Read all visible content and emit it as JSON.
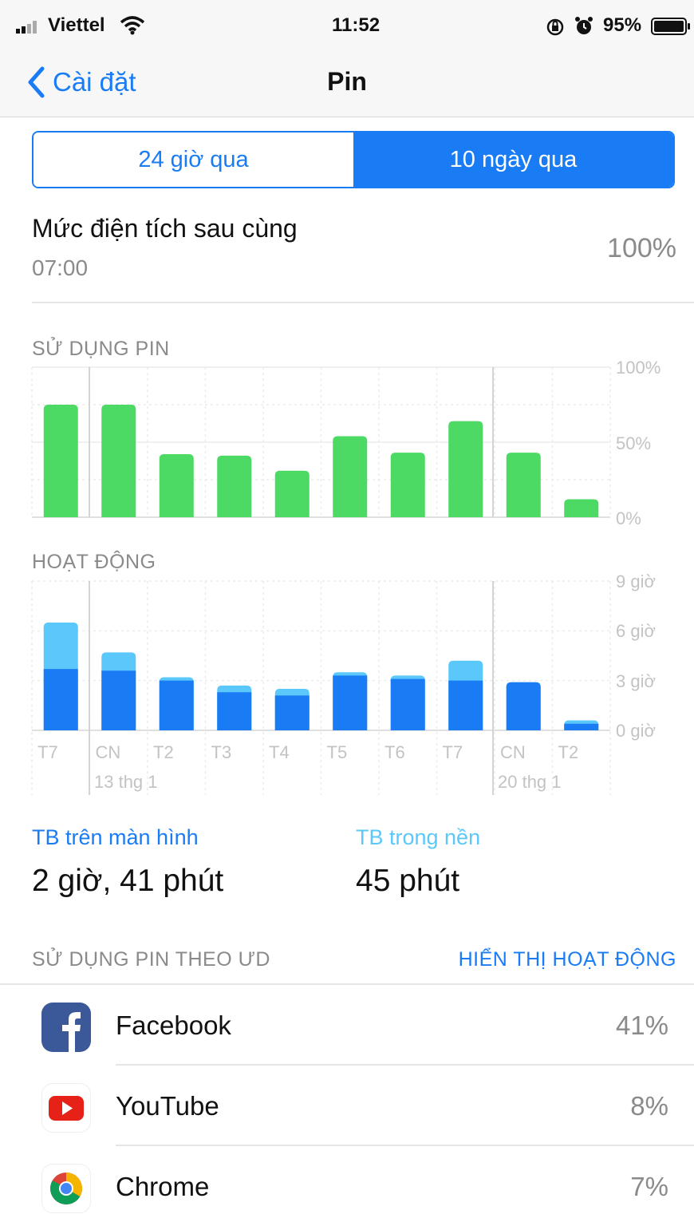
{
  "status": {
    "carrier": "Viettel",
    "time": "11:52",
    "battery": "95%"
  },
  "nav": {
    "back_label": "Cài đặt",
    "title": "Pin"
  },
  "segments": {
    "option1": "24 giờ qua",
    "option2": "10 ngày qua",
    "selected": "10 ngày qua"
  },
  "last_charge": {
    "title": "Mức điện tích sau cùng",
    "time": "07:00",
    "value": "100%"
  },
  "battery_usage": {
    "label": "SỬ DỤNG PIN",
    "ticks": [
      "100%",
      "50%",
      "0%"
    ]
  },
  "activity": {
    "label": "HOẠT ĐỘNG",
    "ticks": [
      "9 giờ",
      "6 giờ",
      "3 giờ",
      "0 giờ"
    ],
    "day_labels": [
      "T7",
      "CN",
      "T2",
      "T3",
      "T4",
      "T5",
      "T6",
      "T7",
      "CN",
      "T2"
    ],
    "date_labels": [
      "13 thg 1",
      "20 thg 1"
    ]
  },
  "chart_data": [
    {
      "type": "bar",
      "title": "SỬ DỤNG PIN",
      "categories": [
        "T7",
        "CN",
        "T2",
        "T3",
        "T4",
        "T5",
        "T6",
        "T7",
        "CN",
        "T2"
      ],
      "values": [
        75,
        75,
        42,
        41,
        31,
        54,
        43,
        64,
        43,
        12
      ],
      "ylim": [
        0,
        100
      ],
      "unit": "%",
      "color": "#4cd964"
    },
    {
      "type": "bar",
      "title": "HOẠT ĐỘNG",
      "categories": [
        "T7",
        "CN",
        "T2",
        "T3",
        "T4",
        "T5",
        "T6",
        "T7",
        "CN",
        "T2"
      ],
      "series": [
        {
          "values": [
            3.7,
            3.6,
            3.0,
            2.3,
            2.1,
            3.3,
            3.1,
            3.0,
            2.9,
            0.4
          ],
          "color": "#1a7cf5"
        },
        {
          "values": [
            2.8,
            1.1,
            0.2,
            0.4,
            0.4,
            0.2,
            0.2,
            1.2,
            0.0,
            0.2
          ],
          "color": "#5ac8fa"
        }
      ],
      "ylim": [
        0,
        9
      ],
      "unit": "giờ"
    }
  ],
  "averages": {
    "screen_label": "TB trên màn hình",
    "screen_value": "2 giờ, 41 phút",
    "background_label": "TB trong nền",
    "background_value": "45 phút"
  },
  "apps": {
    "label": "SỬ DỤNG PIN THEO ƯD",
    "show_activity_label": "HIỂN THỊ HOẠT ĐỘNG",
    "items": [
      {
        "name": "Facebook",
        "percent": "41%",
        "icon": "facebook-icon"
      },
      {
        "name": "YouTube",
        "percent": "8%",
        "icon": "youtube-icon"
      },
      {
        "name": "Chrome",
        "percent": "7%",
        "icon": "chrome-icon"
      }
    ]
  },
  "colors": {
    "accent": "#1a7cf5",
    "usage_bar": "#4cd964",
    "screen_on": "#1a7cf5",
    "background": "#5ac8fa"
  }
}
